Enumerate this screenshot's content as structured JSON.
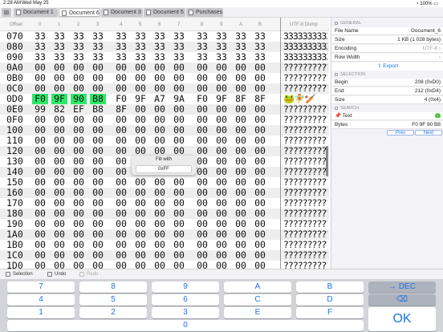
{
  "status": {
    "time": "2:28 AM",
    "date": "Wed May 25",
    "battery": "100%"
  },
  "tabs": [
    {
      "label": "Document 1",
      "active": false
    },
    {
      "label": "Document 6",
      "active": true
    },
    {
      "label": "Document 3",
      "active": false
    },
    {
      "label": "Document 5",
      "active": false
    },
    {
      "label": "Purchases",
      "active": false
    }
  ],
  "header": {
    "offset_label": "Offset",
    "columns": [
      "0",
      "1",
      "2",
      "3",
      "4",
      "5",
      "6",
      "7",
      "8",
      "9",
      "A",
      "B"
    ],
    "dump_label": "UTF-8 Dump"
  },
  "rows": [
    {
      "offset": "070",
      "bytes": [
        "33",
        "33",
        "33",
        "33",
        "33",
        "33",
        "33",
        "33",
        "33",
        "33",
        "33",
        "33"
      ],
      "dump": "3333333333"
    },
    {
      "offset": "080",
      "bytes": [
        "33",
        "33",
        "33",
        "33",
        "33",
        "33",
        "33",
        "33",
        "33",
        "33",
        "33",
        "33"
      ],
      "dump": "3333333333"
    },
    {
      "offset": "090",
      "bytes": [
        "33",
        "33",
        "33",
        "33",
        "33",
        "33",
        "33",
        "33",
        "33",
        "33",
        "33",
        "33"
      ],
      "dump": "3333333333"
    },
    {
      "offset": "0A0",
      "bytes": [
        "00",
        "00",
        "00",
        "00",
        "00",
        "00",
        "00",
        "00",
        "00",
        "00",
        "00",
        "00"
      ],
      "dump": "??????????"
    },
    {
      "offset": "0B0",
      "bytes": [
        "00",
        "00",
        "00",
        "00",
        "00",
        "00",
        "00",
        "00",
        "00",
        "00",
        "00",
        "00"
      ],
      "dump": "??????????"
    },
    {
      "offset": "0C0",
      "bytes": [
        "00",
        "00",
        "00",
        "00",
        "00",
        "00",
        "00",
        "00",
        "00",
        "00",
        "00",
        "00"
      ],
      "dump": "??????????"
    },
    {
      "offset": "0D0",
      "bytes": [
        "F0",
        "9F",
        "90",
        "B8",
        "F0",
        "9F",
        "A7",
        "9A",
        "F0",
        "9F",
        "8F",
        "8F"
      ],
      "dump": "🐸🧚🏏",
      "hl": [
        0,
        1,
        2,
        3
      ]
    },
    {
      "offset": "0E0",
      "bytes": [
        "99",
        "82",
        "EF",
        "B8",
        "8F",
        "00",
        "00",
        "00",
        "00",
        "00",
        "00",
        "00"
      ],
      "dump": "??????????"
    },
    {
      "offset": "0F0",
      "bytes": [
        "00",
        "00",
        "00",
        "00",
        "00",
        "00",
        "00",
        "00",
        "00",
        "00",
        "00",
        "00"
      ],
      "dump": "??????????"
    },
    {
      "offset": "100",
      "bytes": [
        "00",
        "00",
        "00",
        "00",
        "00",
        "00",
        "00",
        "00",
        "00",
        "00",
        "00",
        "00"
      ],
      "dump": "??????????"
    },
    {
      "offset": "110",
      "bytes": [
        "00",
        "00",
        "00",
        "00",
        "00",
        "00",
        "00",
        "00",
        "00",
        "00",
        "00",
        "00"
      ],
      "dump": "??????????"
    },
    {
      "offset": "120",
      "bytes": [
        "00",
        "00",
        "00",
        "00",
        "00",
        "00",
        "00",
        "00",
        "00",
        "00",
        "00",
        "00"
      ],
      "dump": "??????????"
    },
    {
      "offset": "130",
      "bytes": [
        "00",
        "00",
        "00",
        "00",
        "00",
        "00",
        "00",
        "00",
        "00",
        "00",
        "00",
        "00"
      ],
      "dump": "??????????"
    },
    {
      "offset": "140",
      "bytes": [
        "00",
        "00",
        "00",
        "00",
        "00",
        "00",
        "00",
        "00",
        "00",
        "00",
        "00",
        "00"
      ],
      "dump": "??????????"
    },
    {
      "offset": "150",
      "bytes": [
        "00",
        "00",
        "00",
        "00",
        "00",
        "00",
        "00",
        "00",
        "00",
        "00",
        "00",
        "00"
      ],
      "dump": "??????????"
    },
    {
      "offset": "160",
      "bytes": [
        "00",
        "00",
        "00",
        "00",
        "00",
        "00",
        "00",
        "00",
        "00",
        "00",
        "00",
        "00"
      ],
      "dump": "??????????"
    },
    {
      "offset": "170",
      "bytes": [
        "00",
        "00",
        "00",
        "00",
        "00",
        "00",
        "00",
        "00",
        "00",
        "00",
        "00",
        "00"
      ],
      "dump": "??????????"
    },
    {
      "offset": "180",
      "bytes": [
        "00",
        "00",
        "00",
        "00",
        "00",
        "00",
        "00",
        "00",
        "00",
        "00",
        "00",
        "00"
      ],
      "dump": "??????????"
    },
    {
      "offset": "190",
      "bytes": [
        "00",
        "00",
        "00",
        "00",
        "00",
        "00",
        "00",
        "00",
        "00",
        "00",
        "00",
        "00"
      ],
      "dump": "??????????"
    },
    {
      "offset": "1A0",
      "bytes": [
        "00",
        "00",
        "00",
        "00",
        "00",
        "00",
        "00",
        "00",
        "00",
        "00",
        "00",
        "00"
      ],
      "dump": "??????????"
    },
    {
      "offset": "1B0",
      "bytes": [
        "00",
        "00",
        "00",
        "00",
        "00",
        "00",
        "00",
        "00",
        "00",
        "00",
        "00",
        "00"
      ],
      "dump": "??????????"
    },
    {
      "offset": "1C0",
      "bytes": [
        "00",
        "00",
        "00",
        "00",
        "00",
        "00",
        "00",
        "00",
        "00",
        "00",
        "00",
        "00"
      ],
      "dump": "??????????"
    },
    {
      "offset": "1D0",
      "bytes": [
        "00",
        "00",
        "00",
        "00",
        "00",
        "00",
        "00",
        "00",
        "00",
        "00",
        "00",
        "00"
      ],
      "dump": "??????????"
    }
  ],
  "popup": {
    "title": "Fill with",
    "value": "0xFF"
  },
  "panel": {
    "general_label": "GENERAL",
    "file_name_label": "File Name",
    "file_name": "Document_6",
    "size_label": "Size",
    "size": "1 KB (1 028 bytes)",
    "encoding_label": "Encoding",
    "encoding": "UTF-8",
    "row_width_label": "Row Width",
    "export_label": "Export",
    "selection_label": "SELECTION",
    "begin_label": "Begin",
    "begin": "208 (0xD0)",
    "end_label": "End",
    "end": "212 (0xD4)",
    "sel_size_label": "Size",
    "sel_size": "4 (0x4)",
    "search_label": "SEARCH",
    "text_label": "Text",
    "bytes_label": "Bytes",
    "bytes": "F0 9F 90 B8",
    "prev_label": "Prev",
    "next_label": "Next"
  },
  "toolbar": {
    "selection": "Selection",
    "undo": "Undo",
    "redo": "Redo"
  },
  "keypad": {
    "row1": [
      "7",
      "8",
      "9",
      "A",
      "B",
      "→ DEC"
    ],
    "row2": [
      "4",
      "5",
      "6",
      "C",
      "D",
      "⌫"
    ],
    "row3": [
      "1",
      "2",
      "3",
      "E",
      "F"
    ],
    "row4": [
      "0"
    ],
    "ok": "OK"
  }
}
